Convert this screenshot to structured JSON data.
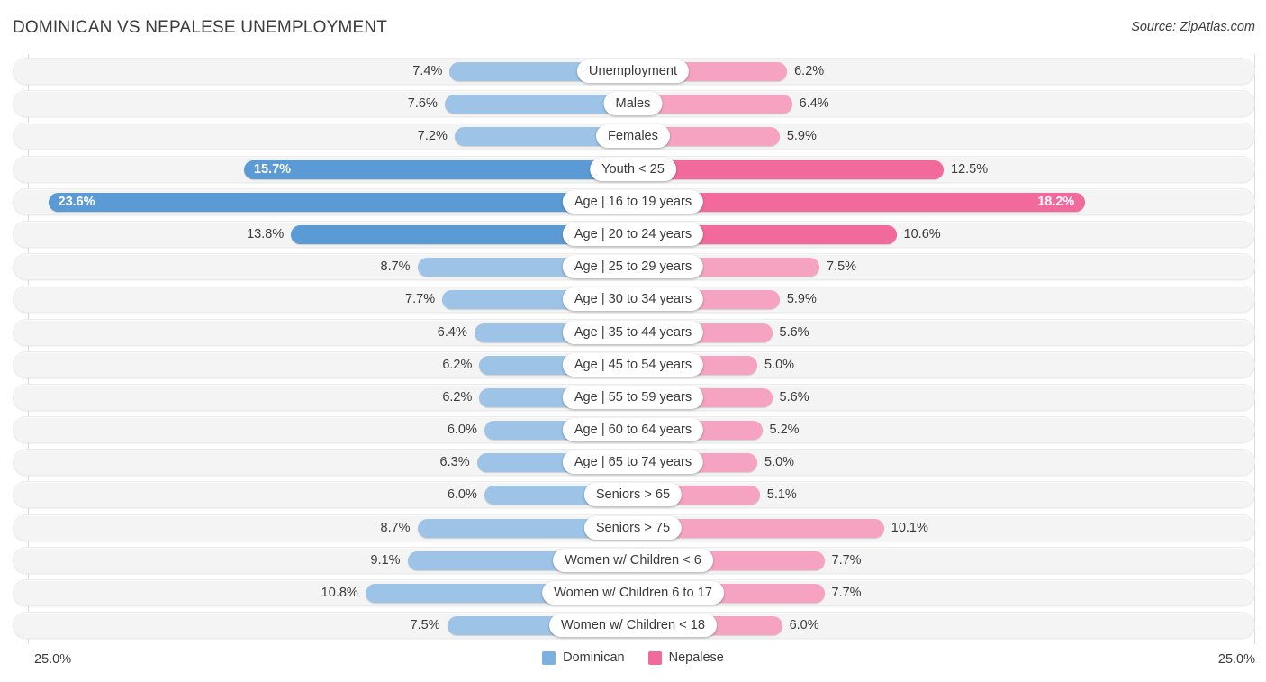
{
  "header": {
    "title": "DOMINICAN VS NEPALESE UNEMPLOYMENT",
    "source": "Source: ZipAtlas.com"
  },
  "footer": {
    "axis_max_left": "25.0%",
    "axis_max_right": "25.0%",
    "legend": [
      {
        "label": "Dominican",
        "color": "#7cb0e0"
      },
      {
        "label": "Nepalese",
        "color": "#f2699c"
      }
    ]
  },
  "colors": {
    "dominican_light": "#9dc3e6",
    "dominican_strong": "#5b9bd5",
    "nepalese_light": "#f5a3c0",
    "nepalese_strong": "#f2699c",
    "track": "#f4f4f4"
  },
  "chart_data": {
    "type": "bar",
    "orientation": "horizontal-diverging",
    "title": "DOMINICAN VS NEPALESE UNEMPLOYMENT",
    "xlabel": "",
    "ylabel": "",
    "xlim": [
      -25.0,
      25.0
    ],
    "axis_max": 25.0,
    "grid": false,
    "legend_position": "bottom-center",
    "unit": "%",
    "categories": [
      "Unemployment",
      "Males",
      "Females",
      "Youth < 25",
      "Age | 16 to 19 years",
      "Age | 20 to 24 years",
      "Age | 25 to 29 years",
      "Age | 30 to 34 years",
      "Age | 35 to 44 years",
      "Age | 45 to 54 years",
      "Age | 55 to 59 years",
      "Age | 60 to 64 years",
      "Age | 65 to 74 years",
      "Seniors > 65",
      "Seniors > 75",
      "Women w/ Children < 6",
      "Women w/ Children 6 to 17",
      "Women w/ Children < 18"
    ],
    "series": [
      {
        "name": "Dominican",
        "color": "#9dc3e6",
        "values": [
          7.4,
          7.6,
          7.2,
          15.7,
          23.6,
          13.8,
          8.7,
          7.7,
          6.4,
          6.2,
          6.2,
          6.0,
          6.3,
          6.0,
          8.7,
          9.1,
          10.8,
          7.5
        ],
        "labels": [
          "7.4%",
          "7.6%",
          "7.2%",
          "15.7%",
          "23.6%",
          "13.8%",
          "8.7%",
          "7.7%",
          "6.4%",
          "6.2%",
          "6.2%",
          "6.0%",
          "6.3%",
          "6.0%",
          "8.7%",
          "9.1%",
          "10.8%",
          "7.5%"
        ]
      },
      {
        "name": "Nepalese",
        "color": "#f5a3c0",
        "values": [
          6.2,
          6.4,
          5.9,
          12.5,
          18.2,
          10.6,
          7.5,
          5.9,
          5.6,
          5.0,
          5.6,
          5.2,
          5.0,
          5.1,
          10.1,
          7.7,
          7.7,
          6.0
        ],
        "labels": [
          "6.2%",
          "6.4%",
          "5.9%",
          "12.5%",
          "18.2%",
          "10.6%",
          "7.5%",
          "5.9%",
          "5.6%",
          "5.0%",
          "5.6%",
          "5.2%",
          "5.0%",
          "5.1%",
          "10.1%",
          "7.7%",
          "7.7%",
          "6.0%"
        ]
      }
    ],
    "rows": [
      {
        "label": "Unemployment",
        "left": 7.4,
        "left_label": "7.4%",
        "left_inside": false,
        "left_emph": false,
        "right": 6.2,
        "right_label": "6.2%",
        "right_inside": false,
        "right_emph": false
      },
      {
        "label": "Males",
        "left": 7.6,
        "left_label": "7.6%",
        "left_inside": false,
        "left_emph": false,
        "right": 6.4,
        "right_label": "6.4%",
        "right_inside": false,
        "right_emph": false
      },
      {
        "label": "Females",
        "left": 7.2,
        "left_label": "7.2%",
        "left_inside": false,
        "left_emph": false,
        "right": 5.9,
        "right_label": "5.9%",
        "right_inside": false,
        "right_emph": false
      },
      {
        "label": "Youth < 25",
        "left": 15.7,
        "left_label": "15.7%",
        "left_inside": true,
        "left_emph": true,
        "right": 12.5,
        "right_label": "12.5%",
        "right_inside": false,
        "right_emph": true
      },
      {
        "label": "Age | 16 to 19 years",
        "left": 23.6,
        "left_label": "23.6%",
        "left_inside": true,
        "left_emph": true,
        "right": 18.2,
        "right_label": "18.2%",
        "right_inside": true,
        "right_emph": true
      },
      {
        "label": "Age | 20 to 24 years",
        "left": 13.8,
        "left_label": "13.8%",
        "left_inside": false,
        "left_emph": true,
        "right": 10.6,
        "right_label": "10.6%",
        "right_inside": false,
        "right_emph": true
      },
      {
        "label": "Age | 25 to 29 years",
        "left": 8.7,
        "left_label": "8.7%",
        "left_inside": false,
        "left_emph": false,
        "right": 7.5,
        "right_label": "7.5%",
        "right_inside": false,
        "right_emph": false
      },
      {
        "label": "Age | 30 to 34 years",
        "left": 7.7,
        "left_label": "7.7%",
        "left_inside": false,
        "left_emph": false,
        "right": 5.9,
        "right_label": "5.9%",
        "right_inside": false,
        "right_emph": false
      },
      {
        "label": "Age | 35 to 44 years",
        "left": 6.4,
        "left_label": "6.4%",
        "left_inside": false,
        "left_emph": false,
        "right": 5.6,
        "right_label": "5.6%",
        "right_inside": false,
        "right_emph": false
      },
      {
        "label": "Age | 45 to 54 years",
        "left": 6.2,
        "left_label": "6.2%",
        "left_inside": false,
        "left_emph": false,
        "right": 5.0,
        "right_label": "5.0%",
        "right_inside": false,
        "right_emph": false
      },
      {
        "label": "Age | 55 to 59 years",
        "left": 6.2,
        "left_label": "6.2%",
        "left_inside": false,
        "left_emph": false,
        "right": 5.6,
        "right_label": "5.6%",
        "right_inside": false,
        "right_emph": false
      },
      {
        "label": "Age | 60 to 64 years",
        "left": 6.0,
        "left_label": "6.0%",
        "left_inside": false,
        "left_emph": false,
        "right": 5.2,
        "right_label": "5.2%",
        "right_inside": false,
        "right_emph": false
      },
      {
        "label": "Age | 65 to 74 years",
        "left": 6.3,
        "left_label": "6.3%",
        "left_inside": false,
        "left_emph": false,
        "right": 5.0,
        "right_label": "5.0%",
        "right_inside": false,
        "right_emph": false
      },
      {
        "label": "Seniors > 65",
        "left": 6.0,
        "left_label": "6.0%",
        "left_inside": false,
        "left_emph": false,
        "right": 5.1,
        "right_label": "5.1%",
        "right_inside": false,
        "right_emph": false
      },
      {
        "label": "Seniors > 75",
        "left": 8.7,
        "left_label": "8.7%",
        "left_inside": false,
        "left_emph": false,
        "right": 10.1,
        "right_label": "10.1%",
        "right_inside": false,
        "right_emph": false
      },
      {
        "label": "Women w/ Children < 6",
        "left": 9.1,
        "left_label": "9.1%",
        "left_inside": false,
        "left_emph": false,
        "right": 7.7,
        "right_label": "7.7%",
        "right_inside": false,
        "right_emph": false
      },
      {
        "label": "Women w/ Children 6 to 17",
        "left": 10.8,
        "left_label": "10.8%",
        "left_inside": false,
        "left_emph": false,
        "right": 7.7,
        "right_label": "7.7%",
        "right_inside": false,
        "right_emph": false
      },
      {
        "label": "Women w/ Children < 18",
        "left": 7.5,
        "left_label": "7.5%",
        "left_inside": false,
        "left_emph": false,
        "right": 6.0,
        "right_label": "6.0%",
        "right_inside": false,
        "right_emph": false
      }
    ]
  }
}
